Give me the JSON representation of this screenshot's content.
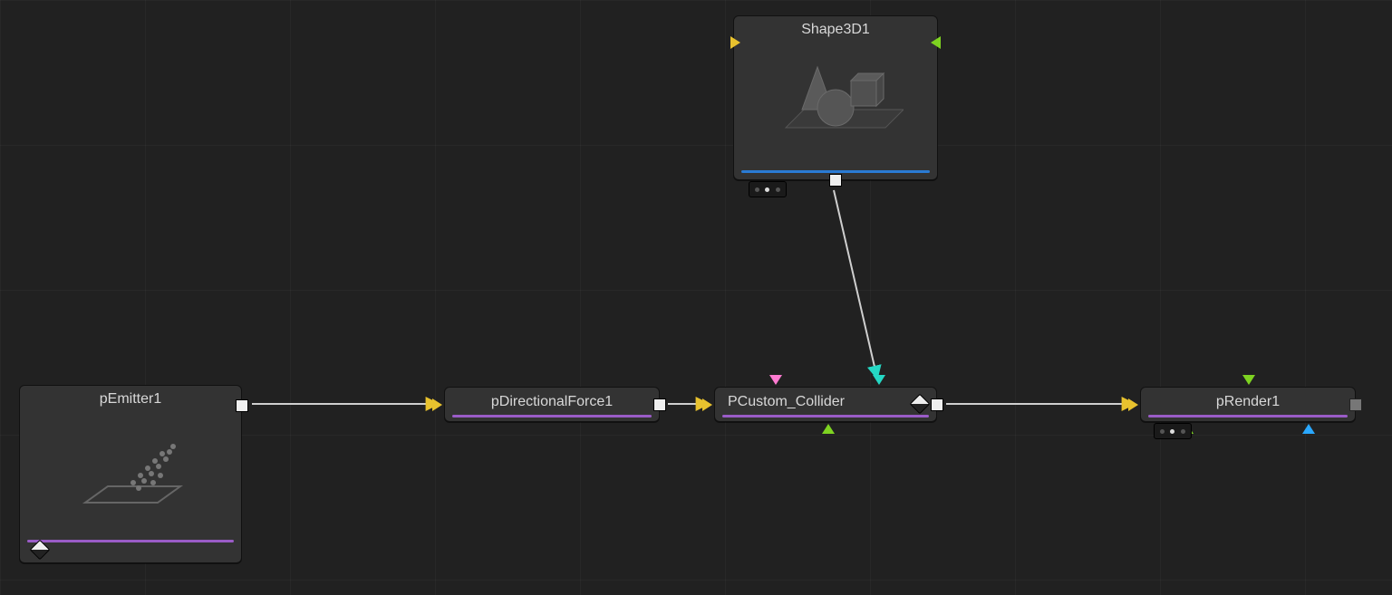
{
  "nodes": {
    "shape3d": {
      "label": "Shape3D1",
      "accent": "#2a7bd4"
    },
    "emitter": {
      "label": "pEmitter1",
      "accent": "#9a5cc7"
    },
    "dirforce": {
      "label": "pDirectionalForce1",
      "accent": "#9a5cc7"
    },
    "collider": {
      "label": "PCustom_Collider",
      "accent": "#9a5cc7"
    },
    "render": {
      "label": "pRender1",
      "accent": "#9a5cc7"
    }
  }
}
